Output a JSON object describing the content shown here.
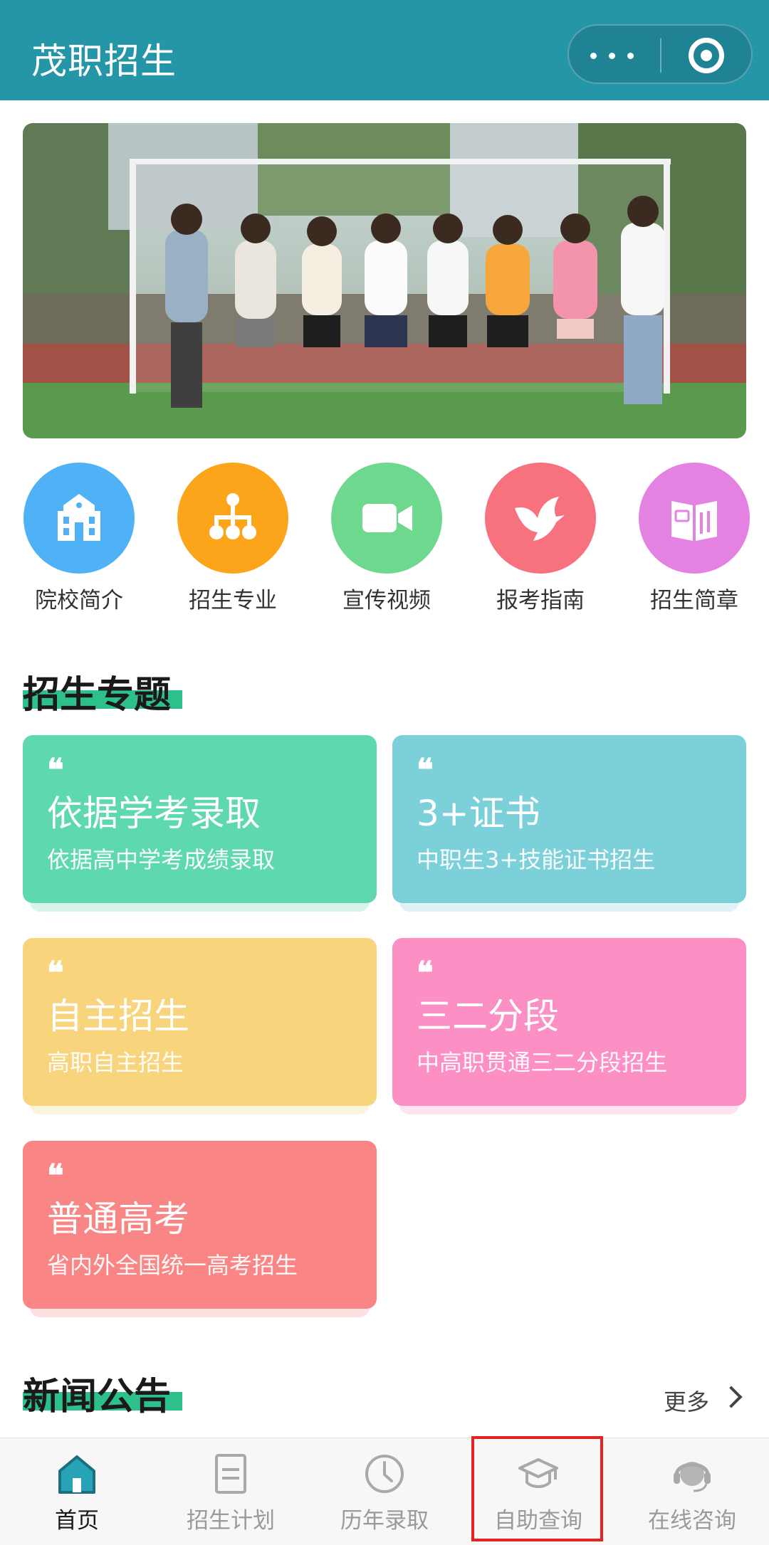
{
  "header": {
    "title": "茂职招生"
  },
  "quick_entries": [
    {
      "label": "院校简介",
      "icon": "school-building-icon",
      "color": "#4fb2f7"
    },
    {
      "label": "招生专业",
      "icon": "org-tree-icon",
      "color": "#fda51a"
    },
    {
      "label": "宣传视频",
      "icon": "video-camera-icon",
      "color": "#6fd88f"
    },
    {
      "label": "报考指南",
      "icon": "dove-icon",
      "color": "#f8717f"
    },
    {
      "label": "招生简章",
      "icon": "open-book-icon",
      "color": "#e482e1"
    }
  ],
  "topics": {
    "title": "招生专题",
    "cards": [
      {
        "quote": "❝",
        "title": "依据学考录取",
        "subtitle": "依据高中学考成绩录取",
        "color": "#5ed8af"
      },
      {
        "quote": "❝",
        "title": "3+证书",
        "subtitle": "中职生3+技能证书招生",
        "color": "#7cd0da"
      },
      {
        "quote": "❝",
        "title": "自主招生",
        "subtitle": "高职自主招生",
        "color": "#f8d47c"
      },
      {
        "quote": "❝",
        "title": "三二分段",
        "subtitle": "中高职贯通三二分段招生",
        "color": "#fc8fc4"
      },
      {
        "quote": "❝",
        "title": "普通高考",
        "subtitle": "省内外全国统一高考招生",
        "color": "#f98584"
      }
    ]
  },
  "news": {
    "title": "新闻公告",
    "more_label": "更多"
  },
  "tabbar": [
    {
      "label": "首页",
      "icon": "home-icon",
      "active": true
    },
    {
      "label": "招生计划",
      "icon": "document-icon",
      "active": false
    },
    {
      "label": "历年录取",
      "icon": "clock-icon",
      "active": false
    },
    {
      "label": "自助查询",
      "icon": "graduation-cap-icon",
      "active": false
    },
    {
      "label": "在线咨询",
      "icon": "headset-icon",
      "active": false
    }
  ]
}
